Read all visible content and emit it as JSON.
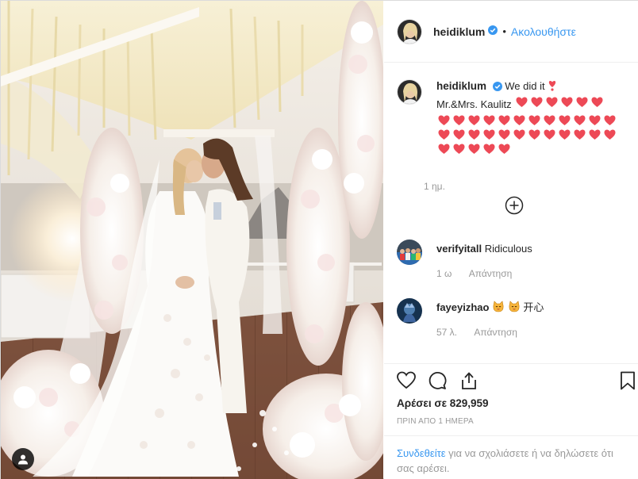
{
  "post": {
    "username": "heidiklum",
    "follow_label": "Ακολουθήστε",
    "dot": "•",
    "image_alt": "Wedding photo of a couple kissing under a floral canopy on a boat deck"
  },
  "caption": {
    "username": "heidiklum",
    "text_line1": "We did it",
    "text_line2": "Mr.&Mrs. Kaulitz",
    "heart_count_line2": 6,
    "heart_count_rows": 29,
    "heart_color": "#ed4956",
    "time": "1 ημ."
  },
  "comments": [
    {
      "username": "verifyitall",
      "text": "Ridiculous",
      "time": "1 ω",
      "reply_label": "Απάντηση"
    },
    {
      "username": "fayeyizhao",
      "text": "开心",
      "time": "57 λ.",
      "reply_label": "Απάντηση"
    }
  ],
  "actions": {
    "likes_text": "Αρέσει σε 829,959",
    "posted_text": "ΠΡΙΝ ΑΠΟ 1 ΗΜΕΡΑ"
  },
  "login": {
    "link_text": "Συνδεθείτε",
    "rest_text": " για να σχολιάσετε ή να δηλώσετε ότι σας αρέσει."
  },
  "colors": {
    "accent": "#3897f0",
    "muted": "#999999",
    "heart": "#ed4956"
  }
}
